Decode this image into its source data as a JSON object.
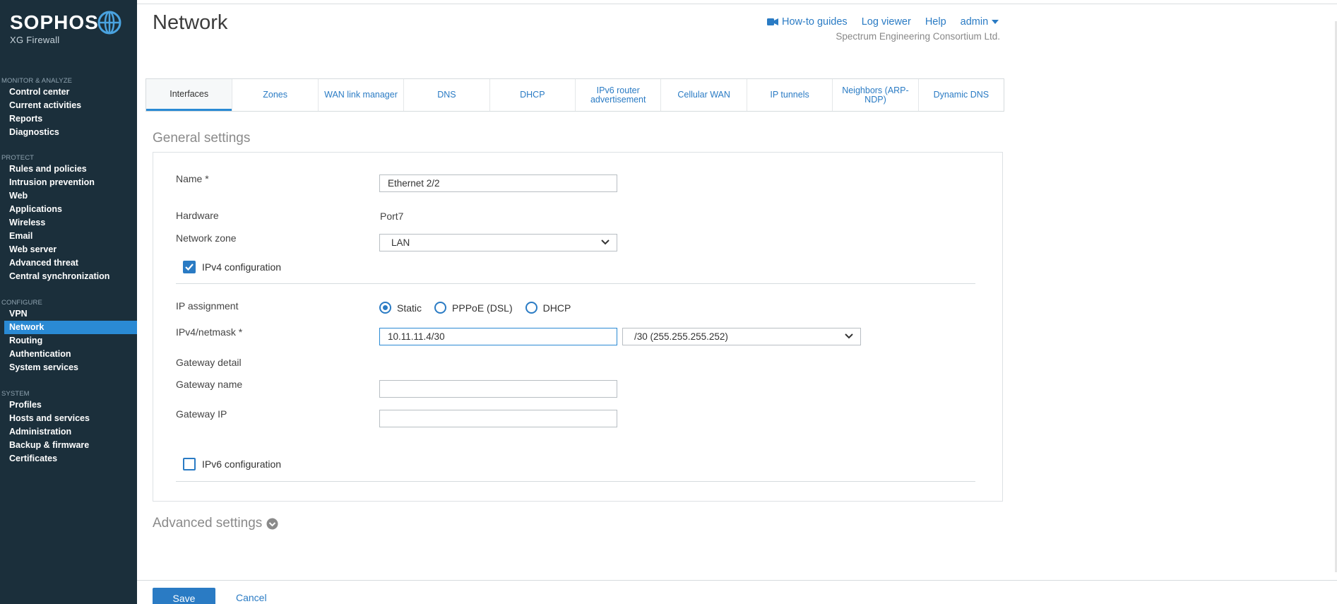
{
  "brand": {
    "name": "SOPHOS",
    "product": "XG Firewall"
  },
  "sidebar": {
    "sections": [
      {
        "header": "MONITOR & ANALYZE",
        "items": [
          "Control center",
          "Current activities",
          "Reports",
          "Diagnostics"
        ]
      },
      {
        "header": "PROTECT",
        "items": [
          "Rules and policies",
          "Intrusion prevention",
          "Web",
          "Applications",
          "Wireless",
          "Email",
          "Web server",
          "Advanced threat",
          "Central synchronization"
        ]
      },
      {
        "header": "CONFIGURE",
        "items": [
          "VPN",
          "Network",
          "Routing",
          "Authentication",
          "System services"
        ]
      },
      {
        "header": "SYSTEM",
        "items": [
          "Profiles",
          "Hosts and services",
          "Administration",
          "Backup & firmware",
          "Certificates"
        ]
      }
    ],
    "active": "Network"
  },
  "header": {
    "title": "Network",
    "links": {
      "howto": "How-to guides",
      "logviewer": "Log viewer",
      "help": "Help",
      "admin": "admin"
    },
    "company": "Spectrum Engineering Consortium Ltd."
  },
  "tabs": [
    "Interfaces",
    "Zones",
    "WAN link manager",
    "DNS",
    "DHCP",
    "IPv6 router advertisement",
    "Cellular WAN",
    "IP tunnels",
    "Neighbors (ARP-NDP)",
    "Dynamic DNS"
  ],
  "active_tab": "Interfaces",
  "general": {
    "title": "General settings",
    "name_label": "Name *",
    "name_value": "Ethernet 2/2",
    "hardware_label": "Hardware",
    "hardware_value": "Port7",
    "zone_label": "Network zone",
    "zone_value": "LAN",
    "ipv4_config_label": "IPv4 configuration",
    "ipv4_config_checked": true,
    "ip_assignment_label": "IP assignment",
    "ip_options": [
      "Static",
      "PPPoE (DSL)",
      "DHCP"
    ],
    "ip_selected": "Static",
    "netmask_label": "IPv4/netmask *",
    "ip_value": "10.11.11.4/30",
    "netmask_value": "/30 (255.255.255.252)",
    "gateway_detail_label": "Gateway detail",
    "gateway_name_label": "Gateway name",
    "gateway_name_value": "",
    "gateway_ip_label": "Gateway IP",
    "gateway_ip_value": "",
    "ipv6_config_label": "IPv6 configuration",
    "ipv6_config_checked": false
  },
  "advanced": {
    "title": "Advanced settings"
  },
  "footer": {
    "save": "Save",
    "cancel": "Cancel"
  },
  "colors": {
    "sidebar_bg": "#1b2f3b",
    "accent": "#2a7bc4",
    "active_nav": "#2a8ad4"
  }
}
